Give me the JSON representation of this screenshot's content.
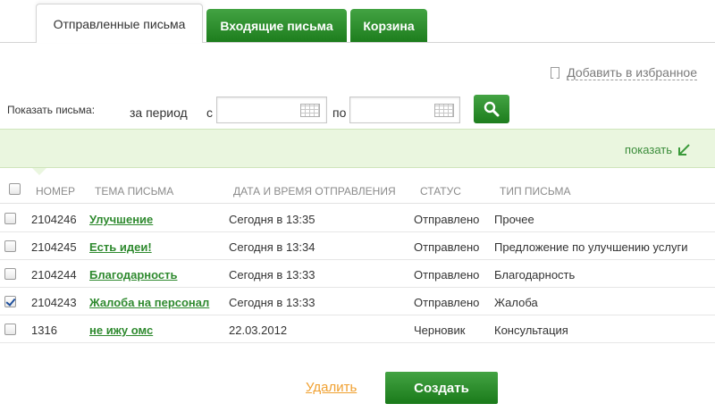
{
  "tabs": {
    "sent": "Отправленные письма",
    "inbox": "Входящие письма",
    "trash": "Корзина"
  },
  "favorite": {
    "label": "Добавить в избранное",
    "icon": "bookmark-icon"
  },
  "filter": {
    "show_label": "Показать письма:",
    "period_label": "за период",
    "from_label": "с",
    "to_label": "по",
    "from_value": "",
    "to_value": "",
    "search_icon": "search-icon"
  },
  "show_bar": {
    "link": "показать",
    "icon": "arrow-down-left-icon"
  },
  "table": {
    "headers": {
      "number": "НОМЕР",
      "subject": "ТЕМА ПИСЬМА",
      "date": "ДАТА И ВРЕМЯ ОТПРАВЛЕНИЯ",
      "status": "СТАТУС",
      "type": "ТИП ПИСЬМА"
    },
    "rows": [
      {
        "number": "2104246",
        "subject": "Улучшение",
        "date": "Сегодня в 13:35",
        "status": "Отправлено",
        "type": "Прочее",
        "checked": false
      },
      {
        "number": "2104245",
        "subject": "Есть идеи!",
        "date": "Сегодня в 13:34",
        "status": "Отправлено",
        "type": "Предложение по улучшению услуги",
        "checked": false
      },
      {
        "number": "2104244",
        "subject": "Благодарность",
        "date": "Сегодня в 13:33",
        "status": "Отправлено",
        "type": "Благодарность",
        "checked": false
      },
      {
        "number": "2104243",
        "subject": "Жалоба на персонал",
        "date": "Сегодня в 13:33",
        "status": "Отправлено",
        "type": "Жалоба",
        "checked": true
      },
      {
        "number": "1316",
        "subject": "не ижу омс",
        "date": "22.03.2012",
        "status": "Черновик",
        "type": "Консультация",
        "checked": false
      }
    ]
  },
  "actions": {
    "delete": "Удалить",
    "create": "Создать"
  },
  "colors": {
    "brand_green": "#2f8a2f",
    "accent_orange": "#f0a030",
    "bar_bg": "#eaf6df"
  }
}
